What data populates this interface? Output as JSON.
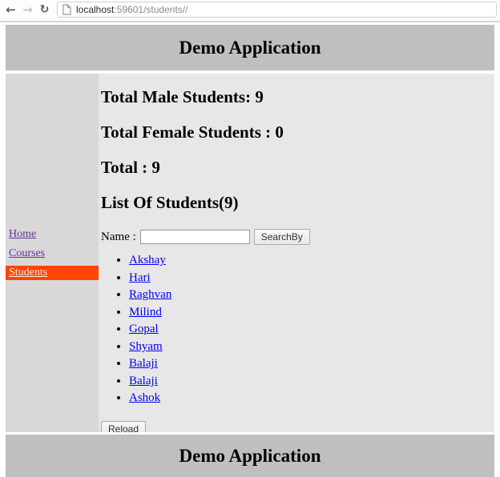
{
  "browser": {
    "url_host": "localhost",
    "url_rest": ":59601/students//",
    "icons": {
      "back": "←",
      "forward": "→",
      "refresh": "↻"
    }
  },
  "header": {
    "title": "Demo Application"
  },
  "footer": {
    "title": "Demo Application"
  },
  "sidebar": {
    "items": [
      {
        "label": "Home",
        "active": false
      },
      {
        "label": "Courses",
        "active": false
      },
      {
        "label": "Students",
        "active": true
      }
    ]
  },
  "main": {
    "stats": [
      "Total Male Students: 9",
      "Total Female Students : 0",
      "Total : 9",
      "List Of Students(9)"
    ],
    "search": {
      "label": "Name :",
      "value": "",
      "button": "SearchBy"
    },
    "students": [
      "Akshay",
      "Hari",
      "Raghvan",
      "Milind",
      "Gopal",
      "Shyam",
      "Balaji",
      "Balaji",
      "Ashok"
    ],
    "reload_button": "Reload"
  },
  "colors": {
    "header_footer_bg": "#bfbfbf",
    "sidebar_bg": "#d8d8d8",
    "main_bg": "#e7e7e7",
    "active_item_bg": "#ff4500",
    "active_item_text": "#f2f2f2",
    "link_blue": "#0000ee",
    "visited_link_purple": "#663399"
  }
}
